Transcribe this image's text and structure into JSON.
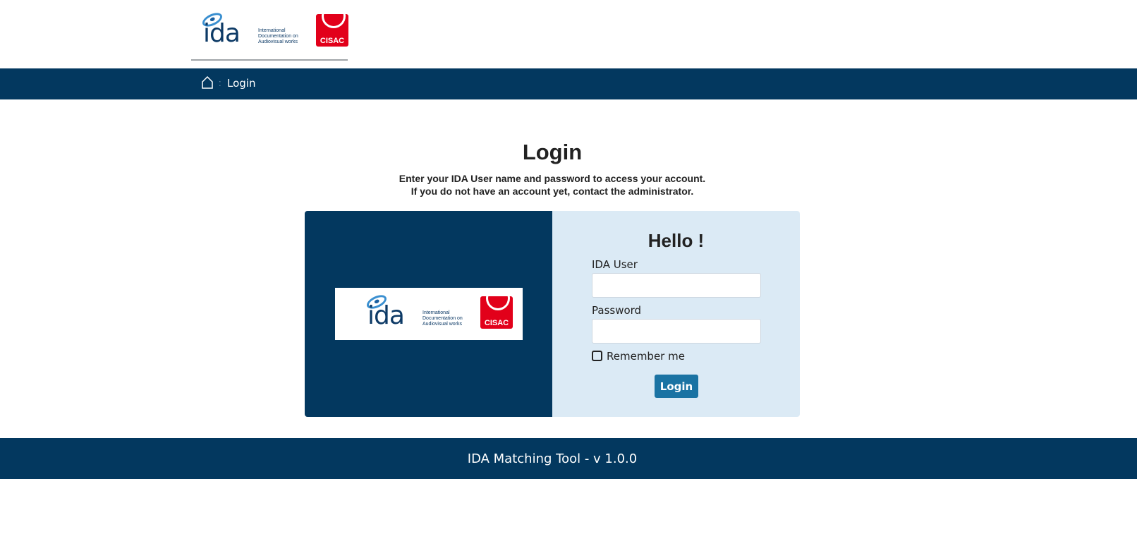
{
  "logo": {
    "name": "ida",
    "tagline": "International Documentation on Audiovisual works",
    "partner": "CISAC"
  },
  "breadcrumb": {
    "separator": ":",
    "current": "Login"
  },
  "page": {
    "title": "Login",
    "subtitle_line1": "Enter your IDA User name and password to access your account.",
    "subtitle_line2": "If you do not have an account yet, contact the administrator."
  },
  "form": {
    "greeting": "Hello !",
    "user_label": "IDA User",
    "user_value": "",
    "password_label": "Password",
    "password_value": "",
    "remember_label": "Remember me",
    "remember_checked": false,
    "submit_label": "Login"
  },
  "footer": {
    "text": "IDA Matching Tool - v 1.0.0"
  },
  "colors": {
    "primary": "#03385f",
    "panel": "#dbeaf5",
    "button": "#1a73a3",
    "cisac": "#e2001a"
  }
}
